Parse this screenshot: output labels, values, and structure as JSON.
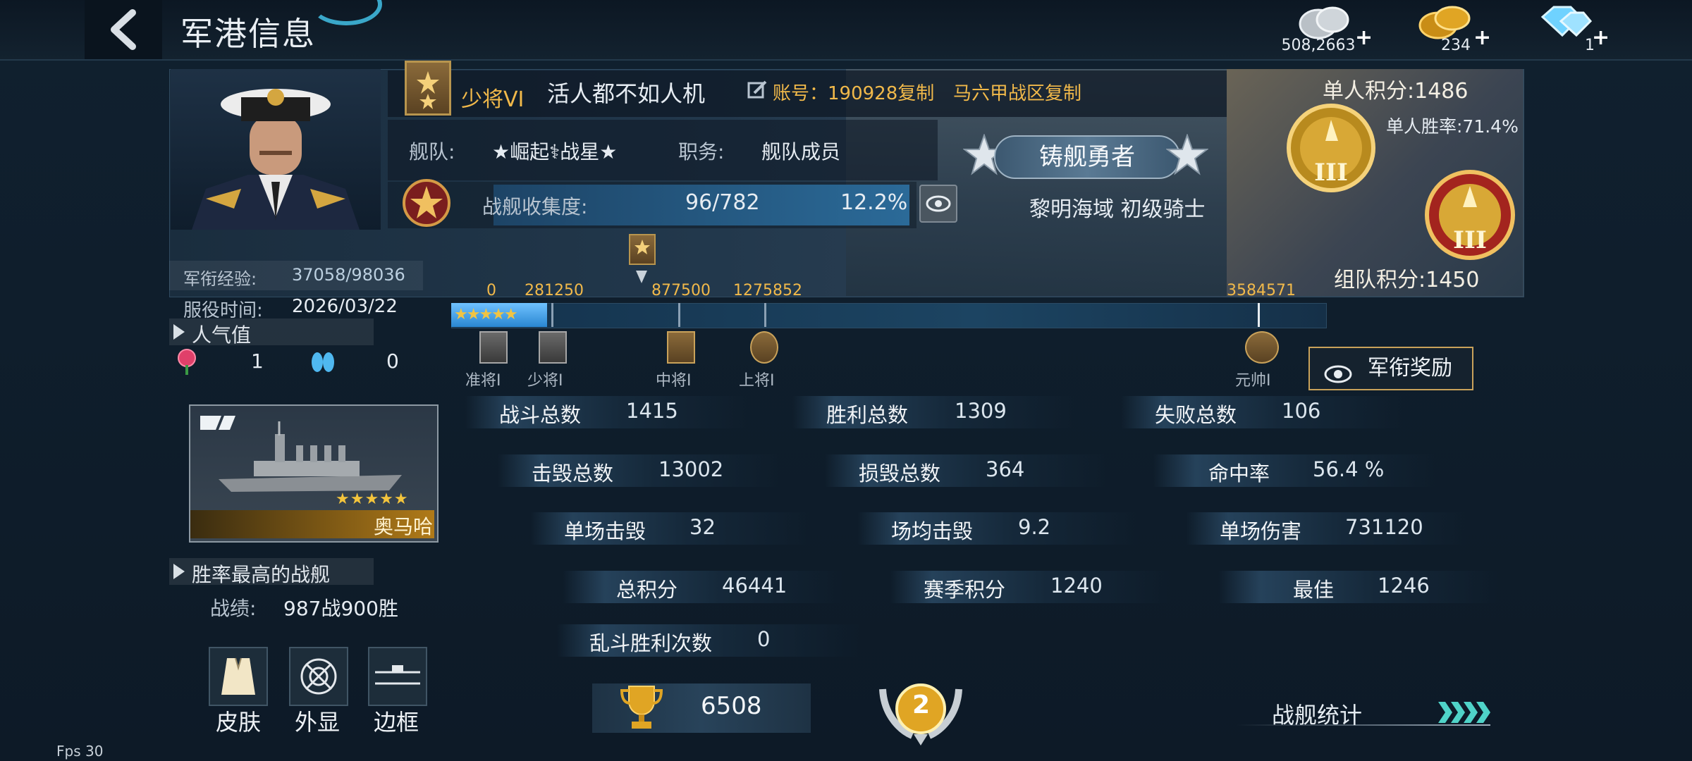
{
  "header": {
    "title": "军港信息",
    "currencies": [
      {
        "name": "silver-coin-icon",
        "value": "508,2663",
        "plus": "+"
      },
      {
        "name": "gold-coin-icon",
        "value": "234",
        "plus": "+"
      },
      {
        "name": "diamond-icon",
        "value": "1",
        "plus": "+"
      }
    ]
  },
  "player": {
    "rank": "少将VI",
    "name": "活人都不如人机",
    "account": "账号：190928复制",
    "server": "马六甲战区复制",
    "fleet_label": "舰队:",
    "fleet_name": "★崛起⚕战星★",
    "duty_label": "职务:",
    "duty_value": "舰队成员",
    "collection_label": "战舰收集度:",
    "collection_value": "96/782",
    "collection_percent": "12.2%",
    "title_badge": "铸舰勇者",
    "region_title": "黎明海域  初级骑士",
    "single_score": "单人积分:1486",
    "single_winrate": "单人胜率:71.4%",
    "team_score": "组队积分:1450",
    "exp_label": "军衔经验:",
    "exp_value": "37058/98036",
    "service_label": "服役时间:",
    "service_value": "2026/03/22"
  },
  "rank_progress": {
    "thresholds": [
      "0",
      "281250",
      "877500",
      "1275852",
      "3584571"
    ],
    "ranks": [
      "准将Ⅰ",
      "少将Ⅰ",
      "中将Ⅰ",
      "上将Ⅰ",
      "元帅Ⅰ"
    ],
    "fill_fraction": 0.11,
    "award_button": "军衔奖励"
  },
  "popularity": {
    "heading": "人气值",
    "rose_count": "1",
    "slipper_count": "0"
  },
  "best_ship": {
    "name": "奥马哈",
    "stars": "★★★★★",
    "heading": "胜率最高的战舰",
    "record_label": "战绩:",
    "record_value": "987战900胜"
  },
  "bottom_buttons": [
    "皮肤",
    "外显",
    "边框"
  ],
  "stats": [
    {
      "label": "战斗总数",
      "value": "1415"
    },
    {
      "label": "胜利总数",
      "value": "1309"
    },
    {
      "label": "失败总数",
      "value": "106"
    },
    {
      "label": "击毁总数",
      "value": "13002"
    },
    {
      "label": "损毁总数",
      "value": "364"
    },
    {
      "label": "命中率",
      "value": "56.4 %"
    },
    {
      "label": "单场击毁",
      "value": "32"
    },
    {
      "label": "场均击毁",
      "value": "9.2"
    },
    {
      "label": "单场伤害",
      "value": "731120"
    },
    {
      "label": "总积分",
      "value": "46441"
    },
    {
      "label": "赛季积分",
      "value": "1240"
    },
    {
      "label": "最佳",
      "value": "1246"
    },
    {
      "label": "乱斗胜利次数",
      "value": "0"
    }
  ],
  "trophy_value": "6508",
  "medal_level": "2",
  "fleet_stats_link": "战舰统计",
  "fps": "Fps 30",
  "colors": {
    "accent_gold": "#f1b94a",
    "bar_blue": "#2a87d2",
    "bg": "#10202f"
  }
}
